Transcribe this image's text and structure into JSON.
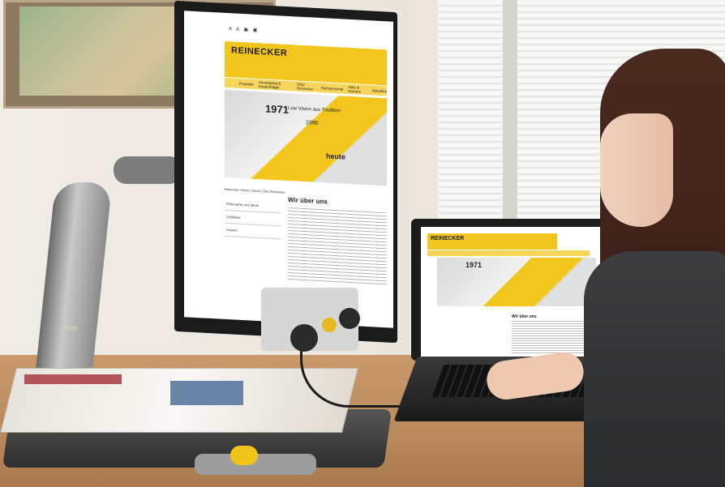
{
  "scene": {
    "description_free": true
  },
  "monitor_site": {
    "toolbar": "A A ▣ ▣",
    "logo": "REINECKER",
    "nav": [
      "Produkte",
      "Versorgung & Kostenträger",
      "Über Reinecker",
      "Fachpersonal",
      "Jobs & Karriere",
      "Aktuelles"
    ],
    "banner_year_1": "1971",
    "banner_tagline": "Low Vision aus Tradition",
    "banner_year_2": "1990",
    "banner_heute": "heute",
    "breadcrumb": "Reinecker Vision | Home | Über Reinecker",
    "sidebar": [
      "Philosophie und Werte",
      "Zertifikate",
      "Historie"
    ],
    "heading": "Wir über uns"
  },
  "laptop_site": {
    "logo": "REINECKER",
    "year": "1971",
    "heading": "Wir über uns"
  },
  "device_label": "Yeo",
  "colors": {
    "brand_yellow": "#f2c61d",
    "monitor_bezel": "#1a1a1a",
    "desk": "#b98a5c",
    "sweater": "#2f3132",
    "hair": "#432519"
  }
}
